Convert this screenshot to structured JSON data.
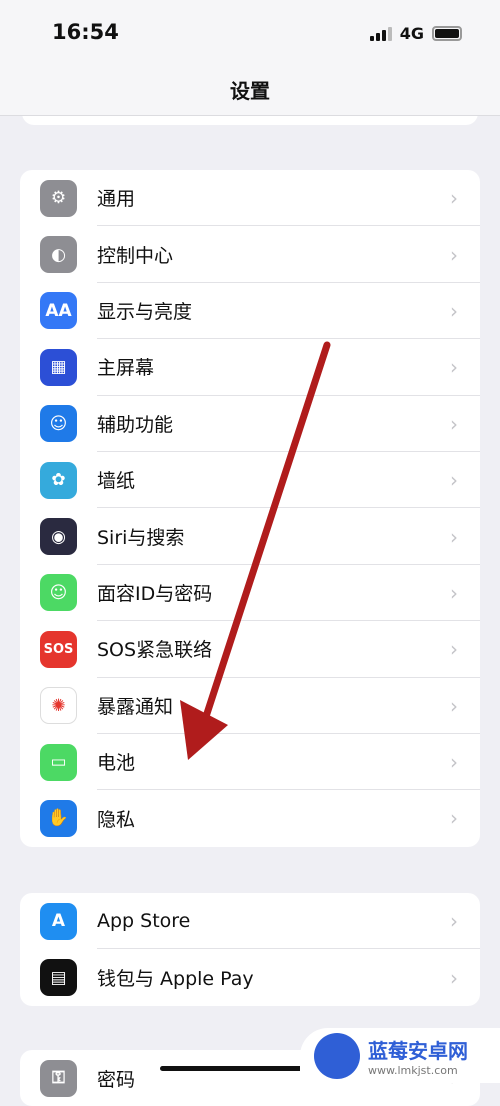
{
  "status": {
    "time": "16:54",
    "network": "4G"
  },
  "header": {
    "title": "设置"
  },
  "groups": [
    {
      "items": [
        {
          "label": "通用",
          "icon": "gear-icon",
          "color": "#8e8e93",
          "glyph": "⚙"
        },
        {
          "label": "控制中心",
          "icon": "toggles-icon",
          "color": "#8e8e93",
          "glyph": "◐"
        },
        {
          "label": "显示与亮度",
          "icon": "text-size-icon",
          "color": "#3478f6",
          "glyph": "AA"
        },
        {
          "label": "主屏幕",
          "icon": "home-screen-icon",
          "color": "#2c4fd6",
          "glyph": "▦"
        },
        {
          "label": "辅助功能",
          "icon": "accessibility-icon",
          "color": "#1f7ae8",
          "glyph": "☺"
        },
        {
          "label": "墙纸",
          "icon": "wallpaper-flower-icon",
          "color": "#35aadc",
          "glyph": "✿"
        },
        {
          "label": "Siri与搜索",
          "icon": "siri-icon",
          "color": "#2a2a40",
          "glyph": "◉"
        },
        {
          "label": "面容ID与密码",
          "icon": "face-id-icon",
          "color": "#4cd964",
          "glyph": "☺"
        },
        {
          "label": "SOS紧急联络",
          "icon": "sos-icon",
          "color": "#e5352d",
          "glyph": "SOS"
        },
        {
          "label": "暴露通知",
          "icon": "exposure-icon",
          "color": "#ffffff",
          "glyph": "✺"
        },
        {
          "label": "电池",
          "icon": "battery-icon",
          "color": "#4cd964",
          "glyph": "▭"
        },
        {
          "label": "隐私",
          "icon": "hand-icon",
          "color": "#1f7ae8",
          "glyph": "✋"
        }
      ]
    },
    {
      "items": [
        {
          "label": "App Store",
          "icon": "app-store-icon",
          "color": "#1f8ef1",
          "glyph": "A"
        },
        {
          "label": "钱包与 Apple Pay",
          "icon": "wallet-icon",
          "color": "#111111",
          "glyph": "▤"
        }
      ]
    },
    {
      "items": [
        {
          "label": "密码",
          "icon": "key-icon",
          "color": "#8e8e93",
          "glyph": "⚿"
        }
      ]
    }
  ],
  "watermark": {
    "name": "蓝莓安卓网",
    "url": "www.lmkjst.com"
  },
  "annotation_color": "#b01c1c"
}
